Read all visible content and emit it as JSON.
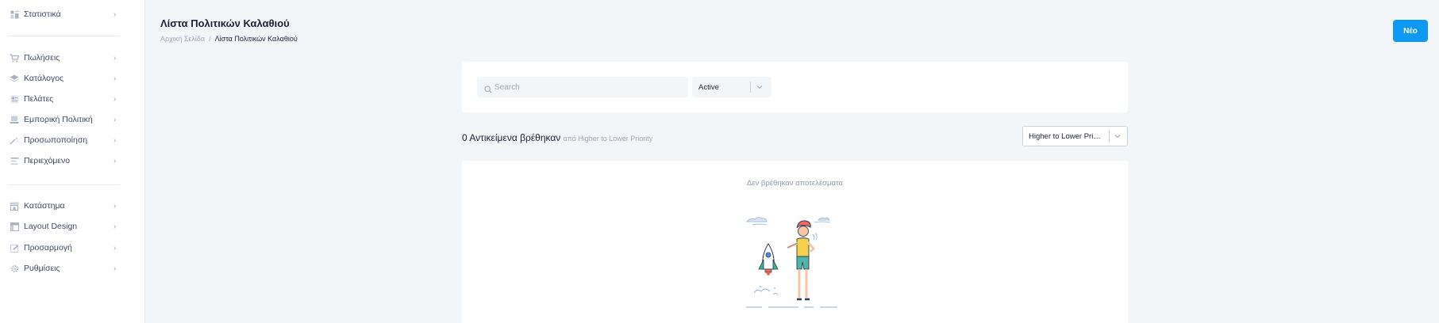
{
  "sidebar": {
    "items": [
      {
        "label": "Στατιστικά",
        "icon": "chart-icon"
      },
      {
        "label": "Πωλήσεις",
        "icon": "cart-icon"
      },
      {
        "label": "Κατάλογος",
        "icon": "layers-icon"
      },
      {
        "label": "Πελάτες",
        "icon": "users-icon"
      },
      {
        "label": "Εμπορική Πολιτική",
        "icon": "policy-icon"
      },
      {
        "label": "Προσωποποίηση",
        "icon": "magic-wand-icon"
      },
      {
        "label": "Περιεχόμενο",
        "icon": "content-icon"
      },
      {
        "label": "Κατάστημα",
        "icon": "store-icon"
      },
      {
        "label": "Layout Design",
        "icon": "layout-icon"
      },
      {
        "label": "Προσαρμογή",
        "icon": "edit-icon"
      },
      {
        "label": "Ρυθμίσεις",
        "icon": "gear-icon"
      }
    ]
  },
  "header": {
    "title": "Λίστα Πολιτικών Καλαθιού",
    "breadcrumb": {
      "home": "Αρχική Σελίδα",
      "separator": "/",
      "current": "Λίστα Πολιτικών Καλαθιού"
    },
    "new_button": "Νέο"
  },
  "filters": {
    "search_placeholder": "Search",
    "search_value": "",
    "status_value": "Active"
  },
  "results": {
    "count_text": "0 Αντικείμενα βρέθηκαν",
    "sort_note": "από Higher to Lower Priority",
    "sort_value": "Higher to Lower Priority"
  },
  "empty_state": {
    "message": "Δεν βρέθηκαν αποτελέσματα"
  },
  "colors": {
    "accent": "#0d99f2",
    "background": "#f3f6f9",
    "text": "#1a1f36",
    "muted": "#9ea7b8"
  }
}
